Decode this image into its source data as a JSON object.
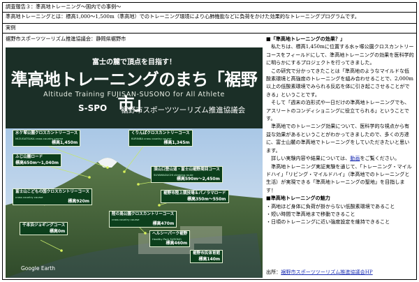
{
  "header": {
    "row1": "調査報告３：準高地トレーニング～国内での事例～",
    "row2": "準高地トレーニングとは：標高1,000～1,500m（準高地）でのトレーニング環境により心肺機能などに負荷をかけた効果的なトレーニングプログラムです。",
    "row3": "実例"
  },
  "left": {
    "caption": "裾野市スポーツツーリズム推進協議会：静岡県裾野市",
    "banner": {
      "subtitle": "富士の麓で頂点を目指す！",
      "title": "準高地トレーニングのまち「裾野市」",
      "english": "Altitude Training FUJISAN-SUSONO for All Athlete",
      "logo": "S-SPO",
      "org": "裾野市スポーツツーリズム推進協議会"
    },
    "map": {
      "watermark": "Google Earth",
      "labels": [
        {
          "name": "水ケ塚公園クロスカントリーコース",
          "sub": "MIZUGATSUKA cross country course",
          "height": "標高1,450m"
        },
        {
          "name": "くりんばクロスカントリーコース",
          "sub": "KURINBA cross country course",
          "height": "標高1,345m"
        },
        {
          "name": "ふじ山麓ロード",
          "sub": "",
          "height": "標高650m～1,040m"
        },
        {
          "name": "須山口登山道・富士山裾野周回コース",
          "sub": "SUYAMAGUCHI climbing route",
          "height": "標高590m～2,450m"
        },
        {
          "name": "富士山こどもの国クロスカントリーコース",
          "sub": "cross country course",
          "height": "標高920m"
        },
        {
          "name": "裾野市陸上競技場＆パノラマロード",
          "sub": "",
          "height": "標高350m～550m"
        },
        {
          "name": "千本浜ジョギングコース",
          "sub": "",
          "height": "標高0m"
        },
        {
          "name": "陸の鳥公園クロスカントリーコース",
          "sub": "cross country course",
          "height": "標高470m"
        },
        {
          "name": "ヘルシーパーク裾野",
          "sub": "Healthy Park SUSONO",
          "height": "標高460m"
        },
        {
          "name": "裾野市民体育館",
          "sub": "",
          "height": "標高140m"
        }
      ]
    }
  },
  "right": {
    "section1_title": "■「準高地トレーニングの効果？」",
    "p1": "私たちは、標高1,450mに位置する水ヶ塚公園クロスカントリーコースをフィールドにして、準高地トレーニングの効果を医科学的に明らかにするプロジェクトを行ってきました。",
    "p2": "この研究で分かってきたことは「準高地のようなマイルドな低酸素環境と高強度のトレーニングを組み合わせることで、2,000m以上の低酸素環境でみられる反応を体に引き起こさせることができる」ということです。",
    "p3": "そして「週末の泊形式や一日だけの準高地トレーニングでも、アスリートのコンディショニングに役立てられる」ということです。",
    "p4": "準高地でのトレーニング効果について、医科学的な視点から有益な効果があるということがわかってきましたので、多くの方達に、富士山麓の準高地でトレーニングをしていただきたいと思います。",
    "p5_pre": "詳しい実験内容や結果については、",
    "p5_link": "動画",
    "p5_post": "をご覧ください。",
    "p6": "準高地トレーニング実証実験を通じて、「トレーニング・マイルドハイ」「リビング・マイルドハイ」（準高地でのトレーニングと生活）が実現できる「準高地トレーニングの聖地」を目指します！",
    "section2_title": "■準高地トレーニングの魅力",
    "bullets": [
      "・高地ほど身体に負荷が掛からない低酸素環境であること",
      "・短い時間で準高地まで移動できること",
      "・日頃のトレーニングに近い強度設定を維持できること"
    ],
    "source_pre": "出所：",
    "source_link": "裾野市スポーツツーリズム推進協議会HP"
  }
}
